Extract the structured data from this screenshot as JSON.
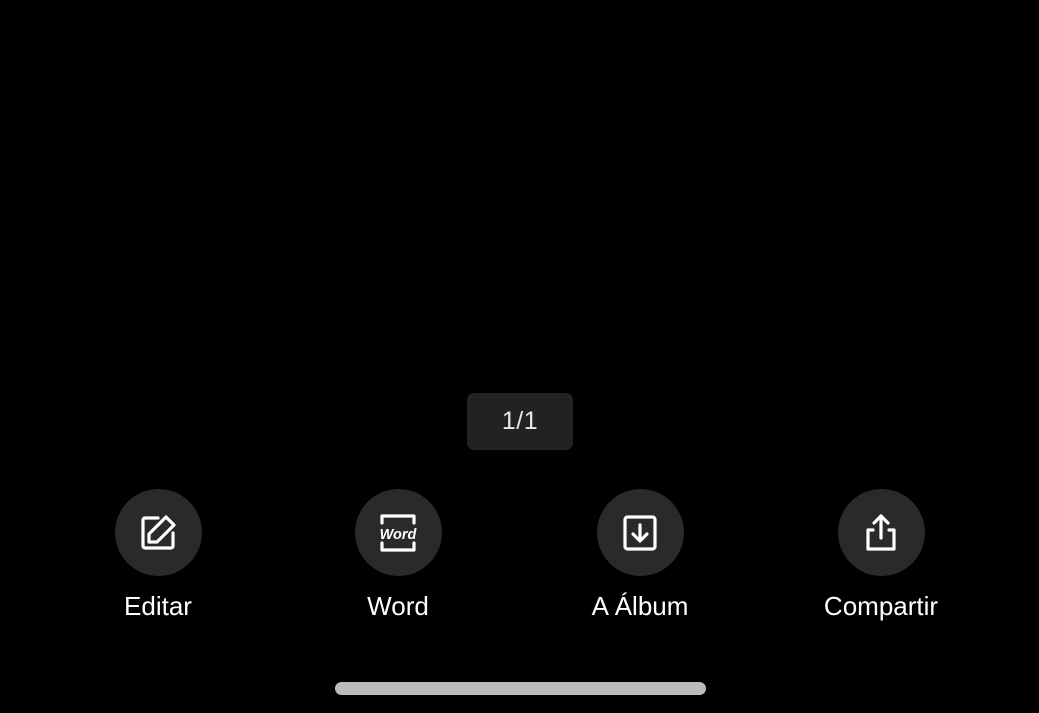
{
  "pager": {
    "text": "1/1"
  },
  "actions": [
    {
      "label": "Editar",
      "icon": "edit-icon"
    },
    {
      "label": "Word",
      "icon": "word-icon",
      "icon_text": "Word"
    },
    {
      "label": "A Álbum",
      "icon": "save-to-album-icon"
    },
    {
      "label": "Compartir",
      "icon": "share-icon"
    }
  ],
  "colors": {
    "background": "#000000",
    "button_circle": "#2a2a2a",
    "pager_background": "#222222",
    "text": "#ffffff",
    "home_indicator": "#bcbcbc"
  }
}
